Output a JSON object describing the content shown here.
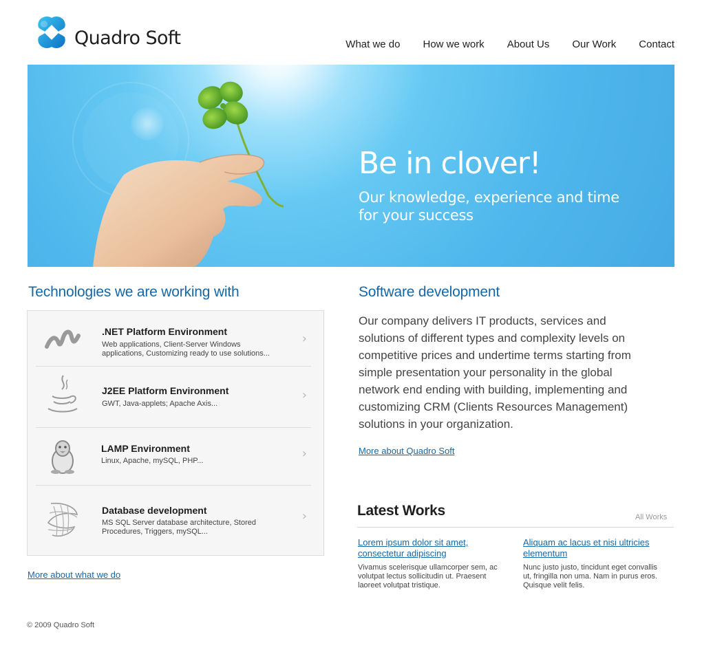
{
  "brand": {
    "name": "Quadro Soft",
    "accent": "#1667a6"
  },
  "nav": [
    {
      "label": "What we do"
    },
    {
      "label": "How we work"
    },
    {
      "label": "About Us"
    },
    {
      "label": "Our Work"
    },
    {
      "label": "Contact"
    }
  ],
  "banner": {
    "title": "Be in clover!",
    "subtitle": "Our knowledge, experience and time for your success"
  },
  "technologies": {
    "heading": "Technologies we are working with",
    "items": [
      {
        "icon": "dotnet-icon",
        "title": ".NET Platform Environment",
        "desc": "Web applications, Client-Server Windows applications, Customizing ready to use solutions..."
      },
      {
        "icon": "java-icon",
        "title": "J2EE Platform Environment",
        "desc": "GWT, Java-applets; Apache Axis..."
      },
      {
        "icon": "linux-penguin-icon",
        "title": "LAMP Environment",
        "desc": "Linux, Apache, mySQL, PHP..."
      },
      {
        "icon": "sql-server-icon",
        "title": "Database development",
        "desc": "MS SQL Server database architecture, Stored Procedures, Triggers, mySQL..."
      }
    ],
    "more_link": "More about what we do"
  },
  "software": {
    "heading": "Software development",
    "text": "Our company delivers IT products, services and solutions of different types and complexity levels on competitive prices and undertime terms starting from simple presentation your personality in the global network end ending with building, implementing and customizing CRM (Clients Resources Management) solutions in your organization.",
    "more_link": "More about Quadro Soft"
  },
  "latest_works": {
    "heading": "Latest Works",
    "all_link": "All Works",
    "items": [
      {
        "title": "Lorem ipsum dolor sit amet, consectetur adipiscing",
        "desc": "Vivamus scelerisque ullamcorper sem, ac volutpat lectus sollicitudin ut. Praesent laoreet volutpat tristique."
      },
      {
        "title": "Aliquam ac lacus et nisi ultricies elementum",
        "desc": "Nunc justo justo, tincidunt eget convallis ut, fringilla non uma. Nam in purus eros. Quisque velit felis."
      }
    ]
  },
  "footer": {
    "copyright": "© 2009 Quadro Soft"
  }
}
